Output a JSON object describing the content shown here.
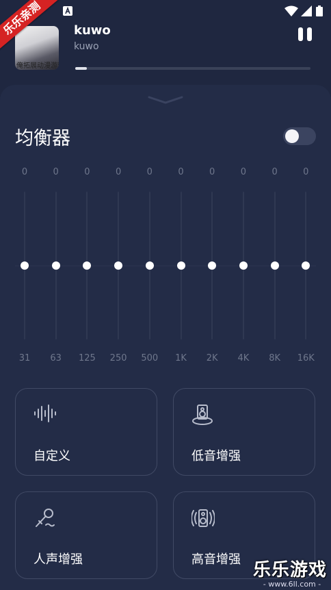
{
  "status_bar": {
    "icons": [
      "a-notification-icon",
      "wifi-icon",
      "cellular-signal-icon",
      "battery-icon"
    ]
  },
  "promo_banner": "乐乐亲测",
  "player": {
    "title": "kuwo",
    "artist": "kuwo",
    "cover_text": "俺拓展动漫游戏",
    "progress": 0.05,
    "pause_icon": "pause-icon"
  },
  "equalizer": {
    "title": "均衡器",
    "enabled": false,
    "bands": [
      {
        "freq": "31",
        "value": "0"
      },
      {
        "freq": "63",
        "value": "0"
      },
      {
        "freq": "125",
        "value": "0"
      },
      {
        "freq": "250",
        "value": "0"
      },
      {
        "freq": "500",
        "value": "0"
      },
      {
        "freq": "1K",
        "value": "0"
      },
      {
        "freq": "2K",
        "value": "0"
      },
      {
        "freq": "4K",
        "value": "0"
      },
      {
        "freq": "8K",
        "value": "0"
      },
      {
        "freq": "16K",
        "value": "0"
      }
    ]
  },
  "presets": [
    {
      "label": "自定义",
      "icon": "waveform-icon"
    },
    {
      "label": "低音增强",
      "icon": "speaker-icon"
    },
    {
      "label": "人声增强",
      "icon": "microphone-icon"
    },
    {
      "label": "高音增强",
      "icon": "tweeter-icon"
    }
  ],
  "watermark": {
    "title": "乐乐游戏",
    "url": "- www.6ll.com -"
  },
  "colors": {
    "background": "#1f2740",
    "sheet": "#232c47",
    "accent_white": "#ffffff",
    "muted_text": "#6f778c"
  }
}
